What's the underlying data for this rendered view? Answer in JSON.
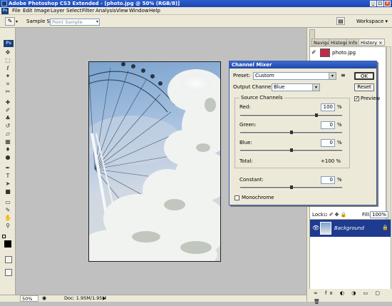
{
  "app": {
    "title": "Adobe Photoshop CS3 Extended - [photo.jpg @ 50% (RGB/8)]",
    "window_buttons": [
      "_",
      "□",
      "×"
    ]
  },
  "menu": [
    "File",
    "Edit",
    "Image",
    "Layer",
    "Select",
    "Filter",
    "Analysis",
    "View",
    "Window",
    "Help"
  ],
  "options": {
    "sample_size_label": "Sample Size:",
    "sample_size_value": "Point Sample",
    "workspace_label": "Workspace ▾"
  },
  "toolbox": {
    "logo": "Ps",
    "tools": [
      "move-tool",
      "marquee-tool",
      "lasso-tool",
      "quick-select-tool",
      "crop-tool",
      "slice-tool",
      "healing-tool",
      "brush-tool",
      "clone-stamp-tool",
      "history-brush-tool",
      "eraser-tool",
      "gradient-tool",
      "blur-tool",
      "dodge-tool",
      "pen-tool",
      "type-tool",
      "path-select-tool",
      "shape-tool",
      "notes-tool",
      "eyedropper-tool",
      "hand-tool",
      "zoom-tool"
    ]
  },
  "status": {
    "zoom": "50%",
    "doc": "Doc: 1.95M/1.95M"
  },
  "panels": {
    "tabs": [
      "Naviga",
      "Histogr",
      "Info",
      "History ×"
    ],
    "history_item": "photo.jpg",
    "lock_label": "Lock:",
    "fill_label": "Fill:",
    "fill_value": "100%",
    "layer_name": "Background"
  },
  "dialog": {
    "title": "Channel Mixer",
    "preset_label": "Preset:",
    "preset_value": "Custom",
    "output_label": "Output Channel:",
    "output_value": "Blue",
    "source_label": "Source Channels",
    "red_label": "Red:",
    "red_value": "100",
    "red_level": 1.0,
    "green_label": "Green:",
    "green_value": "0",
    "green_level": 0.0,
    "blue_label": "Blue:",
    "blue_value": "0",
    "blue_level": 0.0,
    "percent": "%",
    "total_label": "Total:",
    "total_value": "+100 %",
    "constant_label": "Constant:",
    "constant_value": "0",
    "constant_level": 0.0,
    "monochrome_label": "Monochrome",
    "ok": "OK",
    "reset": "Reset",
    "preview_label": "Preview",
    "preview_checked": "✓"
  }
}
